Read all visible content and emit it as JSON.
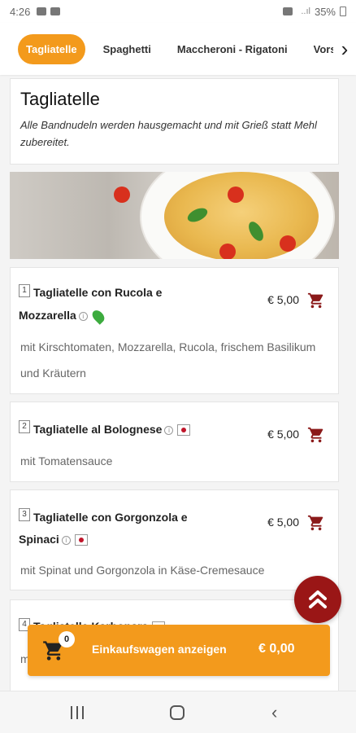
{
  "status_bar": {
    "time": "4:26",
    "signal_text": "..ıl",
    "battery": "35%"
  },
  "tabs": [
    {
      "label": "Tagliatelle",
      "active": true
    },
    {
      "label": "Spaghetti",
      "active": false
    },
    {
      "label": "Maccheroni - Rigatoni",
      "active": false
    },
    {
      "label": "Vors",
      "active": false
    }
  ],
  "section": {
    "title": "Tagliatelle",
    "description": "Alle Bandnudeln werden hausgemacht und mit Grieß statt Mehl zubereitet."
  },
  "items": [
    {
      "number": "1",
      "name_line1": "Tagliatelle con Rucola e",
      "name_line2": "Mozzarella",
      "price": "€ 5,00",
      "description_line1": "mit Kirschtomaten, Mozzarella, Rucola, frischem Basilikum",
      "description_line2": "und Kräutern"
    },
    {
      "number": "2",
      "name_line1": "Tagliatelle al Bolognese",
      "price": "€ 5,00",
      "description_line1": "mit Tomatensauce"
    },
    {
      "number": "3",
      "name_line1": "Tagliatelle con Gorgonzola e",
      "name_line2": "Spinaci",
      "price": "€ 5,00",
      "description_line1": "mit Spinat und Gorgonzola in Käse-Cremesauce"
    },
    {
      "number": "4",
      "name_line1": "Tagliatelle Karbonara",
      "description_line1": "m"
    }
  ],
  "info_symbol": "i",
  "cart": {
    "count": "0",
    "label": "Einkaufswagen anzeigen",
    "total": "€ 0,00"
  },
  "colors": {
    "accent": "#f39a1c",
    "fab": "#9a1616",
    "cart_icon": "#8b1a1a"
  },
  "icons": [
    "shopping-cart-icon",
    "info-icon",
    "vegetarian-leaf-icon",
    "japan-flag-icon",
    "double-chevron-up-icon",
    "chevron-right-icon"
  ]
}
